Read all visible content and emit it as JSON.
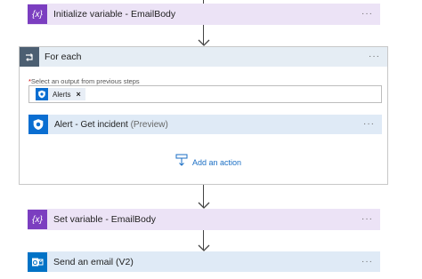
{
  "steps": {
    "init_variable": {
      "title": "Initialize variable - EmailBody",
      "icon": "variable-icon",
      "more": "···"
    },
    "for_each": {
      "title": "For each",
      "icon": "loop-icon",
      "more": "···",
      "select_label_required": "*",
      "select_label": "Select an output from previous steps",
      "token": {
        "label": "Alerts",
        "remove": "×",
        "icon": "shield-icon"
      },
      "inner_action": {
        "title": "Alert - Get incident",
        "subtitle": "(Preview)",
        "icon": "shield-icon",
        "more": "···"
      },
      "add_action": {
        "label": "Add an action",
        "icon": "add-action-icon"
      }
    },
    "set_variable": {
      "title": "Set variable - EmailBody",
      "icon": "variable-icon",
      "more": "···"
    },
    "send_email": {
      "title": "Send an email (V2)",
      "icon": "outlook-icon",
      "more": "···"
    }
  },
  "icons": {
    "variable_glyph": "{x}"
  },
  "colors": {
    "variable_accent": "#7b3ec0",
    "variable_bg": "#ece3f6",
    "loop_accent": "#4c5f72",
    "loop_bg": "#e5edf4",
    "sentinel_accent": "#0a6ed1",
    "action_bg": "#dfeaf6",
    "outlook_accent": "#0072c6",
    "link": "#1a6ec4"
  }
}
